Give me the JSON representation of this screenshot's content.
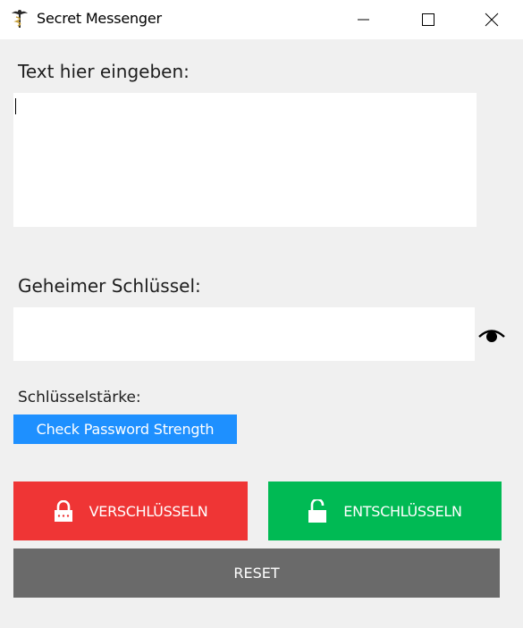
{
  "window": {
    "title": "Secret Messenger",
    "icon": "caduceus-icon",
    "controls": [
      "minimize-icon",
      "maximize-icon",
      "close-icon"
    ]
  },
  "message": {
    "label": "Text hier eingeben:",
    "value": ""
  },
  "key": {
    "label": "Geheimer Schlüssel:",
    "value": "",
    "toggle_icon": "eye-icon"
  },
  "strength": {
    "label": "Schlüsselstärke:",
    "button_label": "Check Password Strength"
  },
  "actions": {
    "encrypt_label": "VERSCHLÜSSELN",
    "encrypt_icon": "lock-closed-icon",
    "decrypt_label": "ENTSCHLÜSSELN",
    "decrypt_icon": "lock-open-icon",
    "reset_label": "RESET"
  },
  "colors": {
    "background": "#f0f0f0",
    "strength_button": "#1e90ff",
    "encrypt_button": "#ef3535",
    "decrypt_button": "#00ba54",
    "reset_button": "#6a6a6a"
  }
}
